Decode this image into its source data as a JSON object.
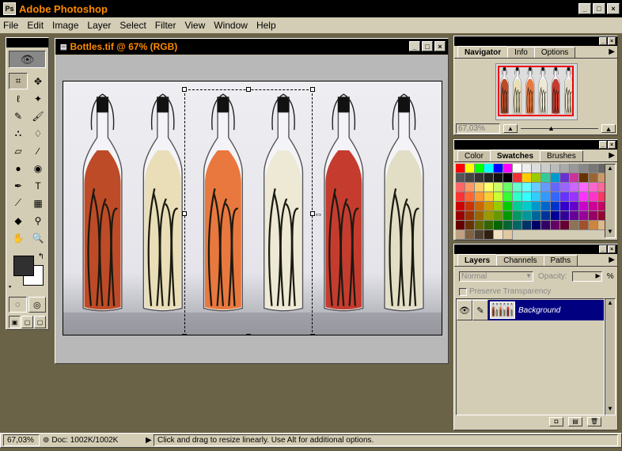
{
  "app": {
    "title": "Adobe Photoshop",
    "icon_label": "Ps"
  },
  "window_buttons": {
    "minimize": "_",
    "maximize": "□",
    "close": "×"
  },
  "menu": [
    "File",
    "Edit",
    "Image",
    "Layer",
    "Select",
    "Filter",
    "View",
    "Window",
    "Help"
  ],
  "document": {
    "title": "Bottles.tif @ 67% (RGB)"
  },
  "tools": [
    {
      "name": "crop-tool",
      "glyph": "⌗",
      "active": true
    },
    {
      "name": "move-tool",
      "glyph": "✥",
      "active": false
    },
    {
      "name": "lasso-tool",
      "glyph": "ℓ",
      "active": false
    },
    {
      "name": "magic-wand-tool",
      "glyph": "✦",
      "active": false
    },
    {
      "name": "airbrush-tool",
      "glyph": "✎",
      "active": false
    },
    {
      "name": "paintbrush-tool",
      "glyph": "🖌",
      "active": false
    },
    {
      "name": "rubber-stamp-tool",
      "glyph": "⛬",
      "active": false
    },
    {
      "name": "history-brush-tool",
      "glyph": "♢",
      "active": false
    },
    {
      "name": "eraser-tool",
      "glyph": "▱",
      "active": false
    },
    {
      "name": "pencil-tool",
      "glyph": "∕",
      "active": false
    },
    {
      "name": "blur-tool",
      "glyph": "●",
      "active": false
    },
    {
      "name": "burn-tool",
      "glyph": "◉",
      "active": false
    },
    {
      "name": "pen-tool",
      "glyph": "✒",
      "active": false
    },
    {
      "name": "type-tool",
      "glyph": "T",
      "active": false
    },
    {
      "name": "measure-tool",
      "glyph": "⟋",
      "active": false
    },
    {
      "name": "gradient-tool",
      "glyph": "▦",
      "active": false
    },
    {
      "name": "paint-bucket-tool",
      "glyph": "◆",
      "active": false
    },
    {
      "name": "eyedropper-tool",
      "glyph": "⚲",
      "active": false
    },
    {
      "name": "hand-tool",
      "glyph": "✋",
      "active": false
    },
    {
      "name": "zoom-tool",
      "glyph": "🔍",
      "active": false
    }
  ],
  "navigator": {
    "tabs": [
      "Navigator",
      "Info",
      "Options"
    ],
    "zoom": "67,03%"
  },
  "swatches": {
    "tabs": [
      "Color",
      "Swatches",
      "Brushes"
    ],
    "colors": [
      "#ff0000",
      "#ffff00",
      "#00ff00",
      "#00ffff",
      "#0000ff",
      "#ff00ff",
      "#ffffff",
      "#eeeeee",
      "#dddddd",
      "#cccccc",
      "#bbbbbb",
      "#aaaaaa",
      "#999999",
      "#888888",
      "#777777",
      "#666666",
      "#555555",
      "#444444",
      "#333333",
      "#222222",
      "#111111",
      "#000000",
      "#ee3333",
      "#ffcc00",
      "#99cc00",
      "#33cc99",
      "#0099cc",
      "#6633cc",
      "#cc3399",
      "#663300",
      "#996633",
      "#cc9966",
      "#ff6666",
      "#ff9966",
      "#ffcc66",
      "#ffff66",
      "#ccff66",
      "#66ff66",
      "#66ffcc",
      "#66ffff",
      "#66ccff",
      "#6699ff",
      "#6666ff",
      "#9966ff",
      "#cc66ff",
      "#ff66ff",
      "#ff66cc",
      "#ff6699",
      "#ff3333",
      "#ff6633",
      "#ff9933",
      "#ffcc33",
      "#ccff33",
      "#33ff33",
      "#33ffcc",
      "#33ffff",
      "#33ccff",
      "#3399ff",
      "#3366ff",
      "#6633ff",
      "#9933ff",
      "#ff33ff",
      "#ff33cc",
      "#ff3366",
      "#cc0000",
      "#cc3300",
      "#cc6600",
      "#cc9900",
      "#99cc00",
      "#00cc00",
      "#00cc99",
      "#00cccc",
      "#0099cc",
      "#0066cc",
      "#0033cc",
      "#3300cc",
      "#6600cc",
      "#cc00cc",
      "#cc0099",
      "#cc0066",
      "#990000",
      "#993300",
      "#996600",
      "#999900",
      "#669900",
      "#009900",
      "#009966",
      "#009999",
      "#006699",
      "#003399",
      "#000099",
      "#330099",
      "#660099",
      "#990099",
      "#990066",
      "#990033",
      "#660000",
      "#663300",
      "#666600",
      "#336600",
      "#006600",
      "#006633",
      "#006666",
      "#003366",
      "#000066",
      "#330066",
      "#660066",
      "#660033",
      "#8b7355",
      "#a0522d",
      "#cd853f",
      "#deb887",
      "#c0a080",
      "#806040",
      "#504030",
      "#302010",
      "#f0e0c0",
      "#e0c8a0"
    ]
  },
  "layers": {
    "tabs": [
      "Layers",
      "Channels",
      "Paths"
    ],
    "blend_mode": "Normal",
    "opacity_label": "Opacity:",
    "opacity_unit": "%",
    "preserve_transparency": "Preserve Transparency",
    "items": [
      {
        "name": "Background"
      }
    ]
  },
  "status": {
    "zoom": "67,03%",
    "doc_info": "Doc: 1002K/1002K",
    "hint": "Click and drag to resize linearly. Use Alt for additional options."
  },
  "image": {
    "bottle_colors": [
      "#b83810",
      "#e8dcb0",
      "#e86a2a",
      "#ece8d0",
      "#c02818",
      "#e0dcc0"
    ]
  }
}
